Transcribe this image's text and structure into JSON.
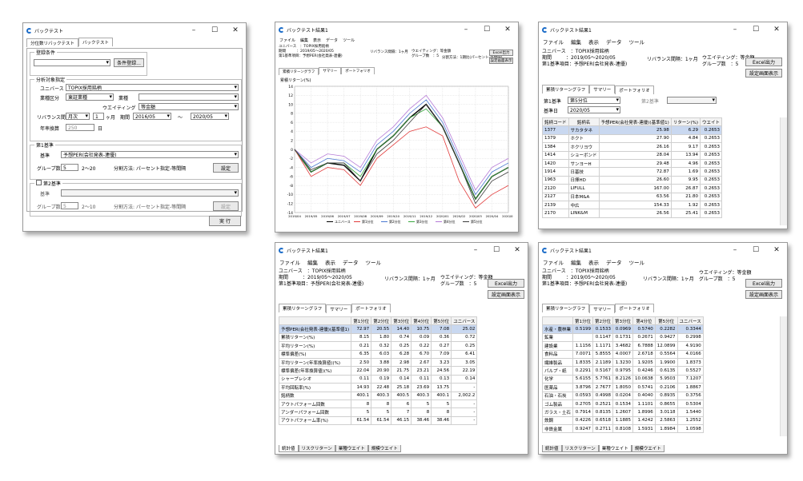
{
  "w1": {
    "title": "バックテスト",
    "tabs": [
      "分位数リバックテスト",
      "バックテスト"
    ],
    "reg": {
      "legend": "登録条件",
      "button": "条件登録..."
    },
    "anal": {
      "legend": "分析対象指定",
      "universe_label": "ユニバース",
      "universe_value": "TOPIX採用銘柄",
      "industry_label": "業種区分",
      "industry_value": "東証業種",
      "gyoshu_label": "業種",
      "weight_label": "ウエイティング",
      "weight_value": "等金額",
      "rebal_label": "リバランス間隔",
      "rebal_value": "月次",
      "rebal_num": "1",
      "month": "ヶ月",
      "period_label": "期間",
      "from": "2016/05",
      "to": "2020/05",
      "tilde": "～",
      "years_label": "年率換算",
      "years_value": "250",
      "days": "日"
    },
    "b1": {
      "legend": "第1基準",
      "basis_label": "基準",
      "basis_value": "予想PER(会社発表-連優)",
      "groups_label": "グループ数",
      "groups_value": "5",
      "range": "2～20",
      "split": "分割方法: パーセント指定-等間隔",
      "button": "設定"
    },
    "b2": {
      "legend": "第2基準",
      "basis_label": "基準",
      "groups_label": "グループ数",
      "groups_value": "5",
      "range": "2～10",
      "split": "分割方法: パーセント指定-等間隔",
      "button": "設定"
    },
    "run": "実 行"
  },
  "common": {
    "title": "バックテスト結果1",
    "menu": [
      "ファイル",
      "編集",
      "表示",
      "データ",
      "ツール"
    ],
    "universe": "ユニバース　：TOPIX採用銘柄",
    "period": "期間　　　：2019/05～2020/05",
    "basis": "第1基準項目：予想PER(会社発表-連優)",
    "rebal": "リバランス間隔：1ヶ月",
    "weight": "ウエイティング：等金額",
    "groups": "グループ数　：5",
    "excel": "Excel出力",
    "settings": "設定画面表示",
    "tabs": [
      "累積リターングラフ",
      "サマリー",
      "ポートフォリオ"
    ]
  },
  "w2": {
    "split": "分割方法：1期比(パーセント-等間隔)",
    "legend": [
      "ユニバース",
      "第1分位",
      "第2分位",
      "第3分位",
      "第4分位",
      "第5分位"
    ],
    "colors": {
      "universe": "#000000",
      "q1": "#e23c3c",
      "q2": "#4a78d0",
      "q3": "#39a83f",
      "q4": "#b57ad6",
      "q5": "#3a3a3a"
    }
  },
  "chart_data": {
    "type": "line",
    "ylabel": "累積リターン(%)",
    "ylim": [
      -14,
      14
    ],
    "yticks": [
      14,
      12,
      10,
      8,
      6,
      4,
      2,
      0,
      -2,
      -4,
      -6,
      -8,
      -10,
      -12,
      -14
    ],
    "categories": [
      "2019/04",
      "2019/05",
      "2019/06",
      "2019/07",
      "2019/08",
      "2019/09",
      "2019/10",
      "2019/11",
      "2019/12",
      "2020/01",
      "2020/02",
      "2020/03",
      "2020/04",
      "2020/05"
    ],
    "series": [
      {
        "name": "ユニバース",
        "values": [
          0,
          -5,
          -3,
          -3.5,
          -7,
          0,
          3,
          7,
          10,
          5,
          -3,
          -11,
          -6,
          -4
        ]
      },
      {
        "name": "第1分位",
        "values": [
          0,
          -6,
          -4,
          -4.5,
          -8,
          -2,
          1,
          4,
          5,
          3,
          -7,
          -13,
          -10,
          -8
        ]
      },
      {
        "name": "第2分位",
        "values": [
          0,
          -4,
          -2,
          -2.5,
          -5,
          1,
          4,
          8,
          11,
          6,
          -2,
          -10,
          -5,
          -3
        ]
      },
      {
        "name": "第3分位",
        "values": [
          0,
          -5,
          -3,
          -3,
          -6,
          0,
          3,
          7,
          9,
          5,
          -3,
          -11,
          -6,
          -4
        ]
      },
      {
        "name": "第4分位",
        "values": [
          0,
          -3,
          -1,
          -1.5,
          -4,
          2,
          5,
          9,
          12,
          7,
          -1,
          -9,
          -4,
          -2
        ]
      },
      {
        "name": "第5分位",
        "values": [
          0,
          -4.5,
          -3,
          -3,
          -7,
          -1,
          2,
          6,
          10,
          5,
          -3,
          -12,
          -7,
          -5
        ]
      }
    ]
  },
  "w3": {
    "basis1_label": "第1基準",
    "basis1_value": "第5分位",
    "basis2_label": "第2基準",
    "date_label": "基準日",
    "date_value": "2020/05",
    "headers": [
      "銘柄コード",
      "銘柄名",
      "予想PER(会社発表-連優)(基準値1)",
      "リターン(%)",
      "ウエイト"
    ],
    "rows": [
      [
        "1377",
        "サカタタネ",
        "25.98",
        "6.29",
        "0.2653"
      ],
      [
        "1379",
        "ホクト",
        "27.90",
        "4.84",
        "0.2653"
      ],
      [
        "1384",
        "ホクリヨウ",
        "26.16",
        "9.17",
        "0.2653"
      ],
      [
        "1414",
        "ショーボンド",
        "28.04",
        "13.94",
        "0.2653"
      ],
      [
        "1420",
        "サンヨーH",
        "29.48",
        "4.96",
        "0.2653"
      ],
      [
        "1914",
        "日基技",
        "72.87",
        "1.69",
        "0.2653"
      ],
      [
        "1963",
        "日揮HD",
        "26.60",
        "9.95",
        "0.2653"
      ],
      [
        "2120",
        "LIFULL",
        "167.00",
        "26.87",
        "0.2653"
      ],
      [
        "2127",
        "日本M&A",
        "63.56",
        "21.80",
        "0.2653"
      ],
      [
        "2139",
        "中広",
        "154.33",
        "1.92",
        "0.2653"
      ],
      [
        "2170",
        "LINK&M",
        "26.56",
        "25.41",
        "0.2653"
      ]
    ]
  },
  "w4": {
    "headers": [
      "",
      "第1分位",
      "第2分位",
      "第3分位",
      "第4分位",
      "第5分位",
      "ユニバース"
    ],
    "rows": [
      [
        "予想PER(会社発表-連優)(基準値1)",
        "72.97",
        "20.55",
        "14.40",
        "10.75",
        "7.08",
        "25.02"
      ],
      [
        "累積リターン(%)",
        "8.15",
        "1.80",
        "0.74",
        "0.09",
        "0.36",
        "0.72"
      ],
      [
        "平均リターン(%)",
        "0.21",
        "0.32",
        "0.25",
        "0.22",
        "0.27",
        "0.25"
      ],
      [
        "標準偏差(%)",
        "6.35",
        "6.03",
        "6.28",
        "6.70",
        "7.09",
        "6.41"
      ],
      [
        "平均リターン(年率換算値)(%)",
        "2.50",
        "3.88",
        "2.98",
        "2.67",
        "3.23",
        "3.05"
      ],
      [
        "標準偏差(年率換算値)(%)",
        "22.04",
        "20.90",
        "21.75",
        "23.21",
        "24.56",
        "22.19"
      ],
      [
        "シャープレシオ",
        "0.11",
        "0.19",
        "0.14",
        "0.11",
        "0.13",
        "0.14"
      ],
      [
        "平均回転率(%)",
        "14.93",
        "22.48",
        "25.18",
        "23.69",
        "13.75",
        "-"
      ],
      [
        "銘柄数",
        "400.1",
        "400.3",
        "400.5",
        "400.3",
        "400.1",
        "2,002.2"
      ],
      [
        "アウトパフォーム回数",
        "8",
        "8",
        "6",
        "5",
        "5",
        "-"
      ],
      [
        "アンダーパフォーム回数",
        "5",
        "5",
        "7",
        "8",
        "8",
        "-"
      ],
      [
        "アウトパフォーム率(%)",
        "61.54",
        "61.54",
        "46.15",
        "38.46",
        "38.46",
        "-"
      ]
    ],
    "btabs": [
      "統計値",
      "リスクリターン",
      "業種ウエイト",
      "規模ウエイト"
    ]
  },
  "w5": {
    "headers": [
      "",
      "第1分位",
      "第2分位",
      "第3分位",
      "第4分位",
      "第5分位",
      "ユニバース"
    ],
    "rows": [
      [
        "水産・農林業",
        "0.5199",
        "0.1533",
        "0.0969",
        "0.5740",
        "0.2282",
        "0.3344"
      ],
      [
        "鉱業",
        "",
        "0.1147",
        "0.1731",
        "0.2671",
        "0.9427",
        "0.2998"
      ],
      [
        "建設業",
        "1.1156",
        "1.1171",
        "3.4682",
        "6.7888",
        "12.0899",
        "4.9190"
      ],
      [
        "食料品",
        "7.0071",
        "5.8555",
        "4.0007",
        "2.6718",
        "0.5564",
        "4.0166"
      ],
      [
        "繊維製品",
        "1.8335",
        "2.1189",
        "1.3230",
        "1.9205",
        "1.9900",
        "1.8373"
      ],
      [
        "パルプ・紙",
        "0.2291",
        "0.5167",
        "0.9795",
        "0.4246",
        "0.6135",
        "0.5527"
      ],
      [
        "化学",
        "5.6155",
        "5.7761",
        "8.2126",
        "10.0638",
        "5.9503",
        "7.1207"
      ],
      [
        "医薬品",
        "3.8796",
        "2.7677",
        "1.8050",
        "0.5741",
        "0.2106",
        "1.8867"
      ],
      [
        "石油・石炭",
        "0.0593",
        "0.4998",
        "0.0204",
        "0.4040",
        "0.8935",
        "0.3756"
      ],
      [
        "ゴム製品",
        "0.2705",
        "0.2521",
        "0.1534",
        "1.1101",
        "0.8655",
        "0.5304"
      ],
      [
        "ガラス・土石",
        "0.7914",
        "0.8135",
        "1.2607",
        "1.8996",
        "3.0118",
        "1.5440"
      ],
      [
        "鉄鋼",
        "0.4226",
        "0.6518",
        "1.1885",
        "1.4242",
        "2.5863",
        "1.2552"
      ],
      [
        "非鉄金属",
        "0.9247",
        "0.2711",
        "0.8108",
        "1.5931",
        "1.8984",
        "1.0598"
      ]
    ],
    "btabs": [
      "統計値",
      "リスクリターン",
      "業種ウエイト",
      "規模ウエイト"
    ]
  }
}
